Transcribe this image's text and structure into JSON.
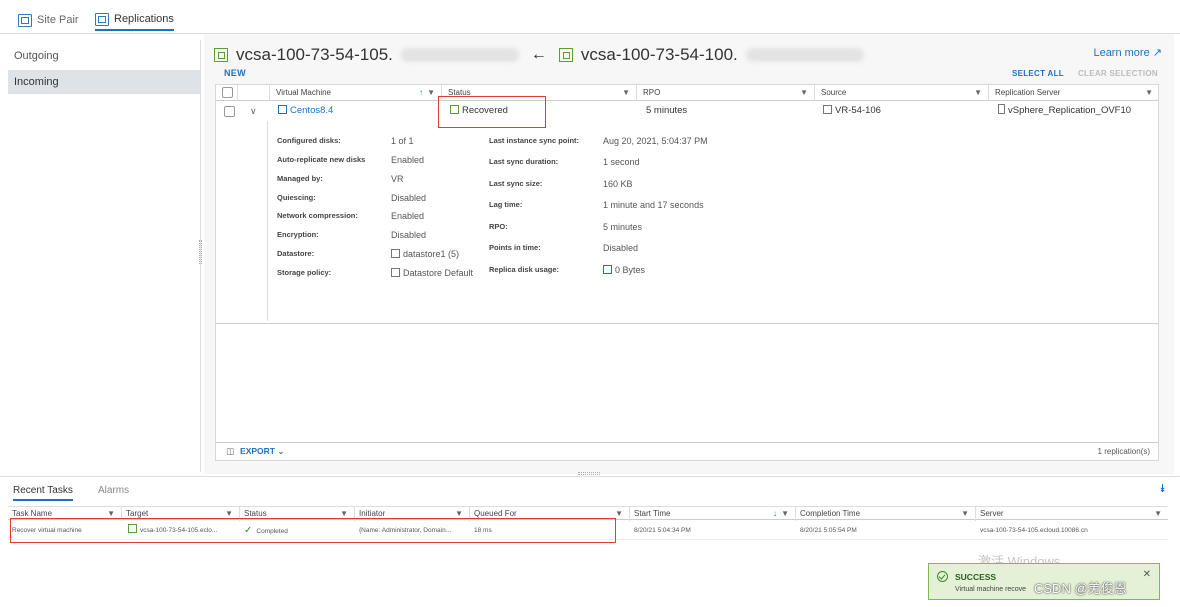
{
  "top_tabs": [
    {
      "label": "Site Pair"
    },
    {
      "label": "Replications"
    }
  ],
  "sidebar": {
    "items": [
      {
        "label": "Outgoing"
      },
      {
        "label": "Incoming"
      }
    ]
  },
  "header": {
    "title_left": "vcsa-100-73-54-105.",
    "arrow": "←",
    "title_right": "vcsa-100-73-54-100.",
    "learn_more": "Learn more",
    "new": "NEW",
    "select_all": "SELECT ALL",
    "clear_selection": "CLEAR SELECTION"
  },
  "grid": {
    "columns": [
      "Virtual Machine",
      "Status",
      "RPO",
      "Source",
      "Replication Server"
    ],
    "row": {
      "vm": "Centos8.4",
      "status": "Recovered",
      "rpo": "5 minutes",
      "source": "VR-54-106",
      "server": "vSphere_Replication_OVF10"
    },
    "details_left": [
      {
        "key": "Configured disks:",
        "value": "1 of 1"
      },
      {
        "key": "Auto-replicate new disks",
        "value": "Enabled"
      },
      {
        "key": "Managed by:",
        "value": "VR"
      },
      {
        "key": "Quiescing:",
        "value": "Disabled"
      },
      {
        "key": "Network compression:",
        "value": "Enabled"
      },
      {
        "key": "Encryption:",
        "value": "Disabled"
      },
      {
        "key": "Datastore:",
        "value": "datastore1 (5)"
      },
      {
        "key": "Storage policy:",
        "value": "Datastore Default"
      }
    ],
    "details_right": [
      {
        "key": "Last instance sync point:",
        "value": "Aug 20, 2021, 5:04:37 PM"
      },
      {
        "key": "Last sync duration:",
        "value": "1 second"
      },
      {
        "key": "Last sync size:",
        "value": "160 KB"
      },
      {
        "key": "Lag time:",
        "value": "1 minute and 17 seconds"
      },
      {
        "key": "RPO:",
        "value": "5 minutes"
      },
      {
        "key": "Points in time:",
        "value": "Disabled"
      },
      {
        "key": "Replica disk usage:",
        "value": "0 Bytes"
      }
    ],
    "export": "EXPORT",
    "count": "1 replication(s)"
  },
  "bottom": {
    "tabs": [
      "Recent Tasks",
      "Alarms"
    ],
    "columns": [
      "Task Name",
      "Target",
      "Status",
      "Initiator",
      "Queued For",
      "Start Time",
      "Completion Time",
      "Server"
    ],
    "task": {
      "name": "Recover virtual machine",
      "target": "vcsa-100-73-54-105.eclo...",
      "status": "Completed",
      "initiator": "{Name: Administrator, Domain...",
      "queued": "18 ms",
      "start": "8/20/21 5:04:34 PM",
      "completion": "8/20/21 5:05:54 PM",
      "server": "vcsa-100-73-54-105.ecloud.10086.cn"
    }
  },
  "overlay": {
    "watermark": "激活 Windows",
    "toast_title": "SUCCESS",
    "toast_text": "Virtual machine recove",
    "credit": "CSDN @羌俊恩"
  },
  "colors": {
    "accent": "#1a73c8",
    "highlight": "#e53935",
    "success": "#3c8b1e"
  }
}
